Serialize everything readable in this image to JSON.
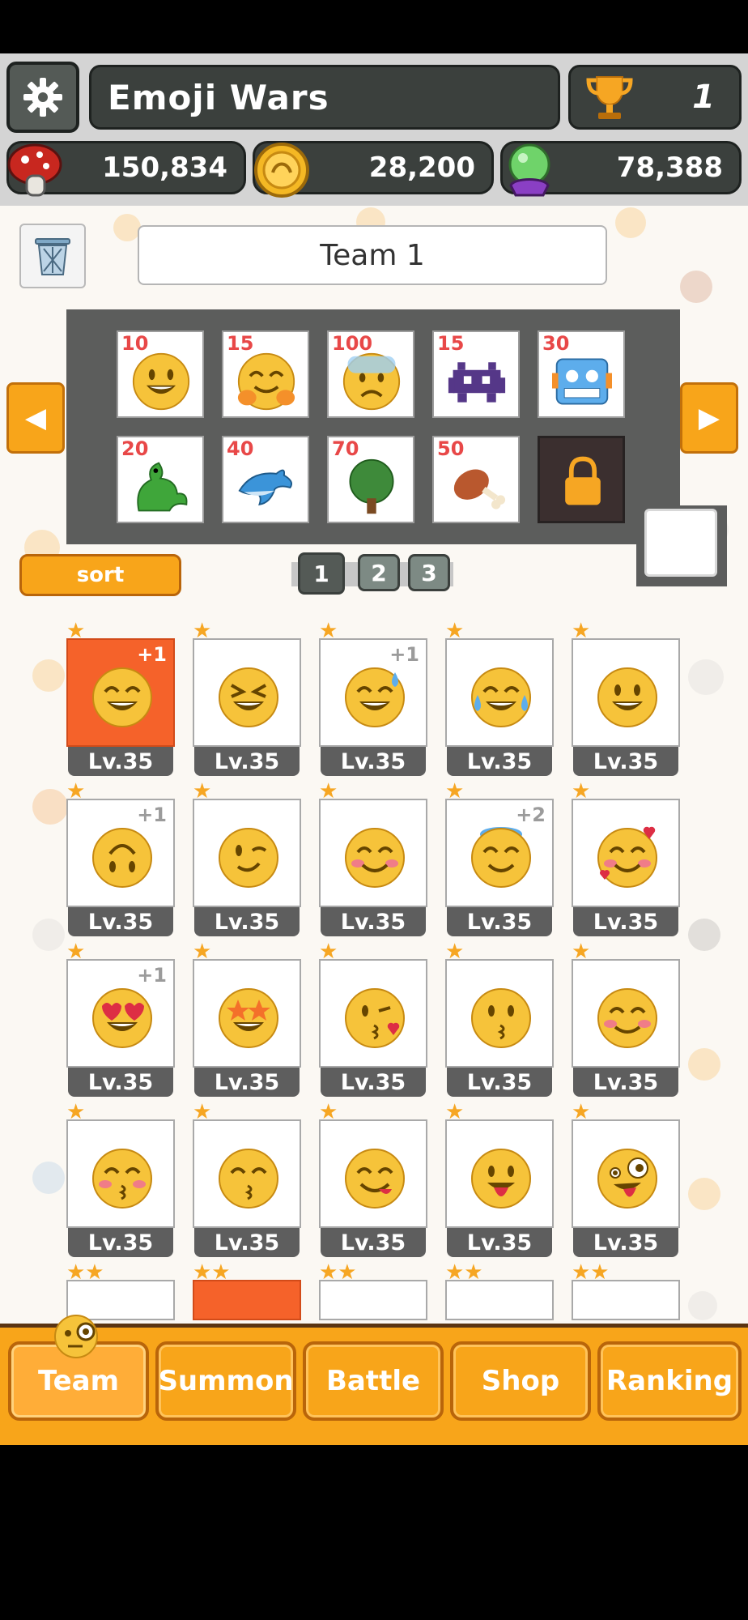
{
  "header": {
    "game_title": "Emoji Wars",
    "trophies": "1"
  },
  "resources": [
    {
      "icon": "mushroom-icon",
      "value": "150,834"
    },
    {
      "icon": "gold-coin-icon",
      "value": "28,200"
    },
    {
      "icon": "crystal-ball-icon",
      "value": "78,388"
    }
  ],
  "team": {
    "name": "Team 1",
    "slots": [
      {
        "cost": "10",
        "emoji": "grinning-face"
      },
      {
        "cost": "15",
        "emoji": "hugging-face"
      },
      {
        "cost": "100",
        "emoji": "anxious-face"
      },
      {
        "cost": "15",
        "emoji": "space-invader"
      },
      {
        "cost": "30",
        "emoji": "robot-face"
      },
      {
        "cost": "20",
        "emoji": "dragon"
      },
      {
        "cost": "40",
        "emoji": "dolphin"
      },
      {
        "cost": "70",
        "emoji": "tree"
      },
      {
        "cost": "50",
        "emoji": "meat-on-bone"
      },
      {
        "cost": "",
        "emoji": "lock"
      }
    ]
  },
  "sort_label": "sort",
  "pages": [
    "1",
    "2",
    "3"
  ],
  "active_page": "1",
  "collection": [
    {
      "level": "Lv.35",
      "stars": "★",
      "plus": "+1",
      "emoji": "grinning-face-smiling-eyes",
      "selected": true
    },
    {
      "level": "Lv.35",
      "stars": "★",
      "plus": "",
      "emoji": "laughing-face"
    },
    {
      "level": "Lv.35",
      "stars": "★",
      "plus": "+1",
      "emoji": "grinning-face-sweat"
    },
    {
      "level": "Lv.35",
      "stars": "★",
      "plus": "",
      "emoji": "tears-of-joy"
    },
    {
      "level": "Lv.35",
      "stars": "★",
      "plus": "",
      "emoji": "grinning-face"
    },
    {
      "level": "Lv.35",
      "stars": "★",
      "plus": "+1",
      "emoji": "upside-down-face"
    },
    {
      "level": "Lv.35",
      "stars": "★",
      "plus": "",
      "emoji": "winking-face"
    },
    {
      "level": "Lv.35",
      "stars": "★",
      "plus": "",
      "emoji": "smiling-blush"
    },
    {
      "level": "Lv.35",
      "stars": "★",
      "plus": "+2",
      "emoji": "halo-face"
    },
    {
      "level": "Lv.35",
      "stars": "★",
      "plus": "",
      "emoji": "smiling-hearts"
    },
    {
      "level": "Lv.35",
      "stars": "★",
      "plus": "+1",
      "emoji": "heart-eyes"
    },
    {
      "level": "Lv.35",
      "stars": "★",
      "plus": "",
      "emoji": "star-struck"
    },
    {
      "level": "Lv.35",
      "stars": "★",
      "plus": "",
      "emoji": "face-blowing-kiss"
    },
    {
      "level": "Lv.35",
      "stars": "★",
      "plus": "",
      "emoji": "kissing-face"
    },
    {
      "level": "Lv.35",
      "stars": "★",
      "plus": "",
      "emoji": "relaxed-face"
    },
    {
      "level": "Lv.35",
      "stars": "★",
      "plus": "",
      "emoji": "kissing-closed-eyes"
    },
    {
      "level": "Lv.35",
      "stars": "★",
      "plus": "",
      "emoji": "kissing-smiling-eyes"
    },
    {
      "level": "Lv.35",
      "stars": "★",
      "plus": "",
      "emoji": "yum-face"
    },
    {
      "level": "Lv.35",
      "stars": "★",
      "plus": "",
      "emoji": "tongue-face"
    },
    {
      "level": "Lv.35",
      "stars": "★",
      "plus": "",
      "emoji": "zany-face"
    },
    {
      "level": "",
      "stars": "★★",
      "plus": "",
      "emoji": "partial"
    },
    {
      "level": "",
      "stars": "★★",
      "plus": "",
      "emoji": "partial",
      "selected": true
    },
    {
      "level": "",
      "stars": "★★",
      "plus": "",
      "emoji": "partial"
    },
    {
      "level": "",
      "stars": "★★",
      "plus": "",
      "emoji": "partial"
    },
    {
      "level": "",
      "stars": "★★",
      "plus": "",
      "emoji": "partial"
    }
  ],
  "nav": [
    {
      "label": "Team",
      "active": true
    },
    {
      "label": "Summon"
    },
    {
      "label": "Battle"
    },
    {
      "label": "Shop"
    },
    {
      "label": "Ranking"
    }
  ],
  "colors": {
    "accent_orange": "#f8a51a",
    "dark_panel": "#3b403d",
    "selected_card": "#f5622a",
    "cost_red": "#e84848"
  }
}
